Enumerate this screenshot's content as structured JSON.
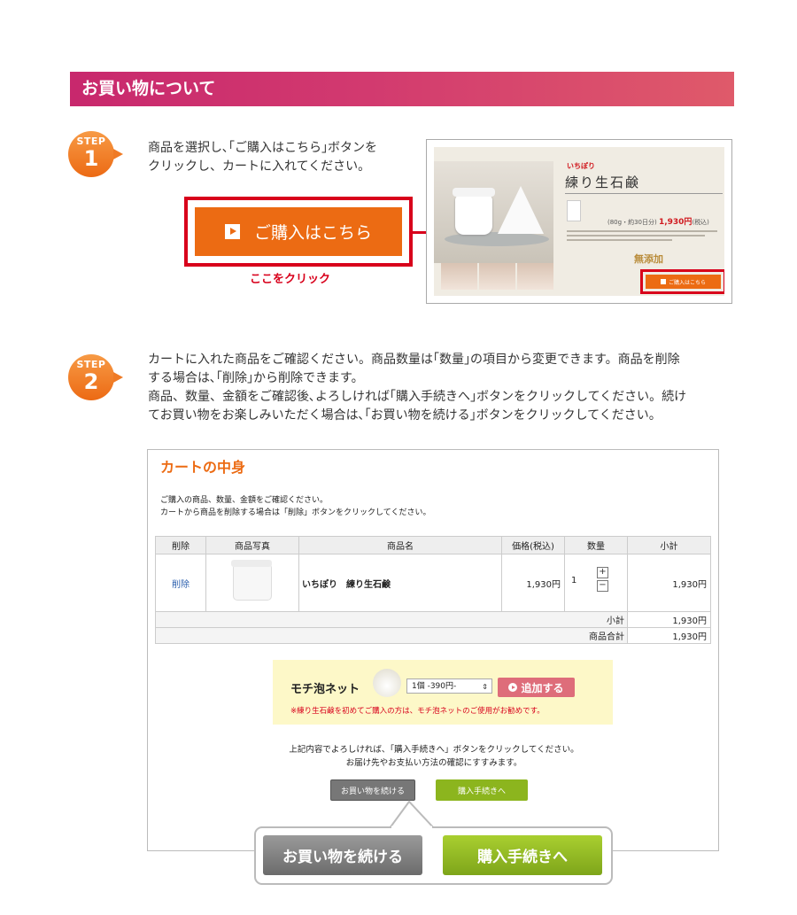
{
  "header": {
    "title": "お買い物について"
  },
  "step1": {
    "word": "STEP",
    "num": "1",
    "text_line1": "商品を選択し､｢ご購入はこちら｣ボタンを",
    "text_line2": "クリックし、カートに入れてください。",
    "button_label": "ご購入はこちら",
    "click_here": "ここをクリック",
    "product": {
      "brand": "いちぽり",
      "title": "練り生石鹸",
      "price_text": "(80g・約30日分)",
      "price": "1,930円",
      "tax": "(税込)",
      "mutenka": "無添加",
      "mini_button": "ご購入はこちら"
    }
  },
  "step2": {
    "word": "STEP",
    "num": "2",
    "text_line1": "カートに入れた商品をご確認ください。商品数量は｢数量｣の項目から変更できます。商品を削除",
    "text_line2": "する場合は､｢削除｣から削除できます。",
    "text_line3": "商品、数量、金額をご確認後､よろしければ｢購入手続きへ｣ボタンをクリックしてください。続け",
    "text_line4": "てお買い物をお楽しみいただく場合は､｢お買い物を続ける｣ボタンをクリックしてください。"
  },
  "cart": {
    "title": "カートの中身",
    "desc_line1": "ご購入の商品、数量、金額をご確認ください。",
    "desc_line2": "カートから商品を削除する場合は「削除」ボタンをクリックしてください。",
    "columns": [
      "削除",
      "商品写真",
      "商品名",
      "価格(税込)",
      "数量",
      "小計"
    ],
    "item": {
      "delete": "削除",
      "name": "いちぽり　練り生石鹸",
      "price": "1,930円",
      "qty": "1",
      "plus": "+",
      "minus": "−",
      "subtotal": "1,930円"
    },
    "subtotal_label": "小計",
    "subtotal_value": "1,930円",
    "total_label": "商品合計",
    "total_value": "1,930円",
    "net": {
      "title": "モチ泡ネット",
      "select": "1個 -390円-",
      "add_button": "追加する",
      "note": "※練り生石鹸を初めてご購入の方は、モチ泡ネットのご使用がお勧めです。"
    },
    "confirm_line1": "上記内容でよろしければ、「購入手続きへ」ボタンをクリックしてください。",
    "confirm_line2": "お届け先やお支払い方法の確認にすすみます。",
    "continue_button": "お買い物を続ける",
    "checkout_button": "購入手続きへ"
  },
  "callout": {
    "continue_button": "お買い物を続ける",
    "checkout_button": "購入手続きへ"
  },
  "colors": {
    "header": "#c8286d",
    "accent_orange": "#ec6b13",
    "highlight_red": "#d8001b",
    "checkout_green": "#8cb51e"
  }
}
